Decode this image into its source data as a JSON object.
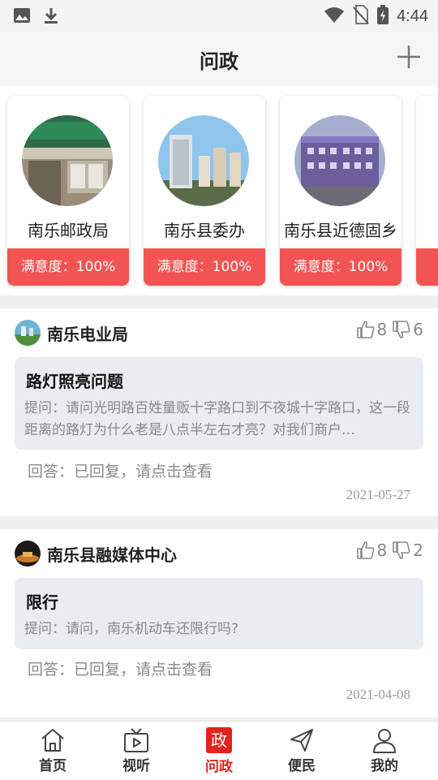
{
  "status_bar": {
    "time": "4:44"
  },
  "header": {
    "title": "问政"
  },
  "departments": [
    {
      "name": "南乐邮政局",
      "satisfaction": "满意度：100%"
    },
    {
      "name": "南乐县委办",
      "satisfaction": "满意度：100%"
    },
    {
      "name": "南乐县近德固乡",
      "satisfaction": "满意度：100%"
    }
  ],
  "posts": [
    {
      "org": "南乐电业局",
      "likes": "8",
      "dislikes": "6",
      "question_title": "路灯照亮问题",
      "question_text": "提问：请问光明路百姓量贩十字路口到不夜城十字路口，这一段距离的路灯为什么老是八点半左右才亮？对我们商户…",
      "answer": "回答：已回复，请点击查看",
      "date": "2021-05-27"
    },
    {
      "org": "南乐县融媒体中心",
      "likes": "8",
      "dislikes": "2",
      "question_title": "限行",
      "question_text": "提问：请问，南乐机动车还限行吗?",
      "answer": "回答：已回复，请点击查看",
      "date": "2021-04-08"
    }
  ],
  "bottom_nav": [
    {
      "label": "首页",
      "icon": "home-icon"
    },
    {
      "label": "视听",
      "icon": "tv-icon"
    },
    {
      "label": "问政",
      "icon": "zheng-icon",
      "badge": "政",
      "active": true
    },
    {
      "label": "便民",
      "icon": "send-icon"
    },
    {
      "label": "我的",
      "icon": "user-icon"
    }
  ],
  "colors": {
    "accent": "#e0241f",
    "satisfaction_bg": "#f25454",
    "question_bg": "#e9ecf1"
  }
}
